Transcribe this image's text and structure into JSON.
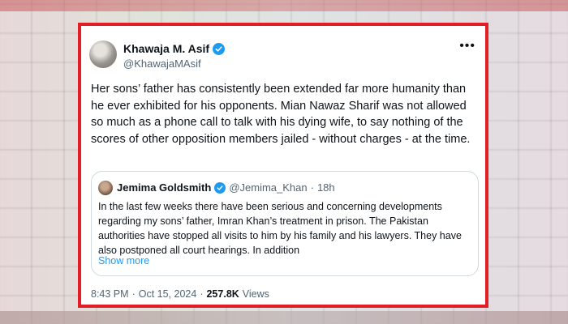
{
  "tweet": {
    "author_name": "Khawaja M. Asif",
    "author_handle": "@KhawajaMAsif",
    "more_icon": "more-horizontal-icon",
    "text": "Her sons’ father has consistently been extended far more humanity than he ever exhibited for his opponents. Mian Nawaz Sharif was not allowed so much as a phone call to talk with his dying wife, to say nothing of the scores of other opposition members jailed - without charges - at the time.",
    "time": "8:43 PM",
    "date": "Oct 15, 2024",
    "separator": "·",
    "views_count": "257.8K",
    "views_label": "Views"
  },
  "quote": {
    "author_name": "Jemima Goldsmith",
    "author_handle": "@Jemima_Khan",
    "separator": "·",
    "age": "18h",
    "text": "In the last few weeks there have been serious and concerning developments regarding my sons’ father, Imran Khan’s treatment in prison. The Pakistan authorities have stopped all visits to him by his family and his lawyers. They have also postponed all court hearings. In addition",
    "show_more": "Show more"
  },
  "colors": {
    "frame_border": "#e11d26",
    "verified_blue": "#1d9bf0",
    "secondary_text": "#536471",
    "primary_text": "#0f1419"
  }
}
